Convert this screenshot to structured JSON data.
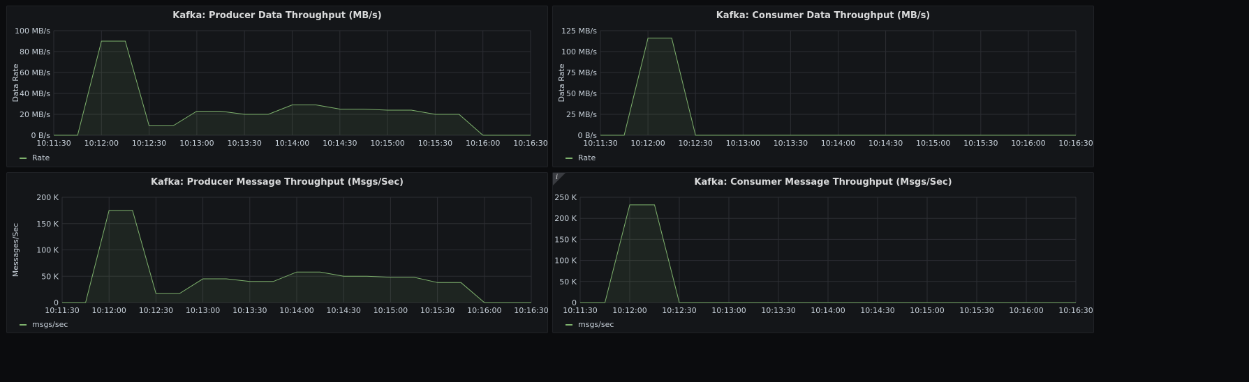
{
  "colors": {
    "series": "#7eb26d",
    "fill": "rgba(126,178,109,0.10)",
    "grid": "#2c2e33",
    "panel_bg": "#141619"
  },
  "panels": [
    {
      "title": "Kafka: Producer Data Throughput (MB/s)",
      "legend": "Rate",
      "info_icon": false,
      "chart_data": {
        "type": "area",
        "ylabel": "Data Rate",
        "x_ticks": [
          "10:11:30",
          "10:12:00",
          "10:12:30",
          "10:13:00",
          "10:13:30",
          "10:14:00",
          "10:14:30",
          "10:15:00",
          "10:15:30",
          "10:16:00",
          "10:16:30"
        ],
        "y_ticks": [
          "0 B/s",
          "20 MB/s",
          "40 MB/s",
          "60 MB/s",
          "80 MB/s",
          "100 MB/s"
        ],
        "ylim": [
          0,
          100
        ],
        "series": [
          {
            "name": "Rate",
            "x": [
              "10:11:30",
              "10:11:45",
              "10:12:00",
              "10:12:15",
              "10:12:30",
              "10:12:45",
              "10:13:00",
              "10:13:15",
              "10:13:30",
              "10:13:45",
              "10:14:00",
              "10:14:15",
              "10:14:30",
              "10:14:45",
              "10:15:00",
              "10:15:15",
              "10:15:30",
              "10:15:45",
              "10:16:00",
              "10:16:15",
              "10:16:30"
            ],
            "values": [
              0,
              0,
              90,
              90,
              9,
              9,
              23,
              23,
              20,
              20,
              29,
              29,
              25,
              25,
              24,
              24,
              20,
              20,
              0,
              0,
              0
            ]
          }
        ]
      }
    },
    {
      "title": "Kafka: Consumer Data Throughput (MB/s)",
      "legend": "Rate",
      "info_icon": false,
      "chart_data": {
        "type": "area",
        "ylabel": "Data Rate",
        "x_ticks": [
          "10:11:30",
          "10:12:00",
          "10:12:30",
          "10:13:00",
          "10:13:30",
          "10:14:00",
          "10:14:30",
          "10:15:00",
          "10:15:30",
          "10:16:00",
          "10:16:30"
        ],
        "y_ticks": [
          "0 B/s",
          "25 MB/s",
          "50 MB/s",
          "75 MB/s",
          "100 MB/s",
          "125 MB/s"
        ],
        "ylim": [
          0,
          125
        ],
        "series": [
          {
            "name": "Rate",
            "x": [
              "10:11:30",
              "10:11:45",
              "10:12:00",
              "10:12:15",
              "10:12:30",
              "10:12:45",
              "10:13:00",
              "10:13:30",
              "10:14:00",
              "10:14:30",
              "10:15:00",
              "10:15:30",
              "10:16:00",
              "10:16:30"
            ],
            "values": [
              0,
              0,
              116,
              116,
              0,
              0,
              0,
              0,
              0,
              0,
              0,
              0,
              0,
              0
            ]
          }
        ]
      }
    },
    {
      "title": "Kafka: Producer Message Throughput (Msgs/Sec)",
      "legend": "msgs/sec",
      "info_icon": false,
      "chart_data": {
        "type": "area",
        "ylabel": "Messages/Sec",
        "x_ticks": [
          "10:11:30",
          "10:12:00",
          "10:12:30",
          "10:13:00",
          "10:13:30",
          "10:14:00",
          "10:14:30",
          "10:15:00",
          "10:15:30",
          "10:16:00",
          "10:16:30"
        ],
        "y_ticks": [
          "0",
          "50 K",
          "100 K",
          "150 K",
          "200 K"
        ],
        "ylim": [
          0,
          200
        ],
        "series": [
          {
            "name": "msgs/sec",
            "x": [
              "10:11:30",
              "10:11:45",
              "10:12:00",
              "10:12:15",
              "10:12:30",
              "10:12:45",
              "10:13:00",
              "10:13:15",
              "10:13:30",
              "10:13:45",
              "10:14:00",
              "10:14:15",
              "10:14:30",
              "10:14:45",
              "10:15:00",
              "10:15:15",
              "10:15:30",
              "10:15:45",
              "10:16:00",
              "10:16:15",
              "10:16:30"
            ],
            "values": [
              0,
              0,
              175,
              175,
              17,
              17,
              45,
              45,
              40,
              40,
              58,
              58,
              50,
              50,
              48,
              48,
              38,
              38,
              0,
              0,
              0
            ]
          }
        ]
      }
    },
    {
      "title": "Kafka: Consumer Message Throughput (Msgs/Sec)",
      "legend": "msgs/sec",
      "info_icon": true,
      "info_glyph": "i",
      "chart_data": {
        "type": "area",
        "ylabel": "",
        "x_ticks": [
          "10:11:30",
          "10:12:00",
          "10:12:30",
          "10:13:00",
          "10:13:30",
          "10:14:00",
          "10:14:30",
          "10:15:00",
          "10:15:30",
          "10:16:00",
          "10:16:30"
        ],
        "y_ticks": [
          "0",
          "50 K",
          "100 K",
          "150 K",
          "200 K",
          "250 K"
        ],
        "ylim": [
          0,
          250
        ],
        "series": [
          {
            "name": "msgs/sec",
            "x": [
              "10:11:30",
              "10:11:45",
              "10:12:00",
              "10:12:15",
              "10:12:30",
              "10:12:45",
              "10:13:00",
              "10:13:30",
              "10:14:00",
              "10:14:30",
              "10:15:00",
              "10:15:30",
              "10:16:00",
              "10:16:30"
            ],
            "values": [
              0,
              0,
              232,
              232,
              0,
              0,
              0,
              0,
              0,
              0,
              0,
              0,
              0,
              0
            ]
          }
        ]
      }
    }
  ]
}
